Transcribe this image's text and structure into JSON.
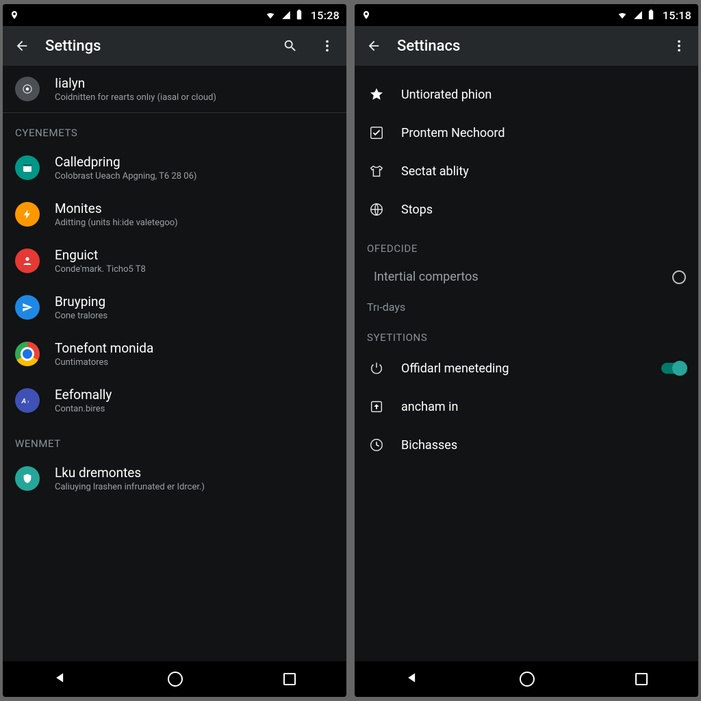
{
  "phones": {
    "left": {
      "statusbar": {
        "time": "15:28"
      },
      "appbar": {
        "title": "Settings",
        "has_search": true,
        "has_more": true
      },
      "hero": {
        "title": "Iialyn",
        "subtitle": "Coidnitten for rearts onlıy (iasal or cloud)"
      },
      "sections": [
        {
          "header": "CYENEMETS",
          "items": [
            {
              "title": "Calledpring",
              "subtitle": "Colobrast Ueach Apgning, T6 28 06)",
              "icon": "calendar",
              "color": "c-teal"
            },
            {
              "title": "Monites",
              "subtitle": "Aditting (units hi:ide valetegoo)",
              "icon": "bolt",
              "color": "c-orange"
            },
            {
              "title": "Enguict",
              "subtitle": "Conde'mark. Ticho5 T8",
              "icon": "person",
              "color": "c-red"
            },
            {
              "title": "Bruyping",
              "subtitle": "Cone tralores",
              "icon": "send",
              "color": "c-blue"
            },
            {
              "title": "Tonefont monida",
              "subtitle": "Cuntimatores",
              "icon": "chrome",
              "color": "c-chrome"
            },
            {
              "title": "Eefomally",
              "subtitle": "Contan.bires",
              "icon": "az",
              "color": "c-azure"
            }
          ]
        },
        {
          "header": "WENMET",
          "items": [
            {
              "title": "Lku dremontes",
              "subtitle": "Caliuying lrashen infrunated er Idrcer.)",
              "icon": "shield",
              "color": "c-mint"
            }
          ]
        }
      ]
    },
    "right": {
      "statusbar": {
        "time": "15:18"
      },
      "appbar": {
        "title": "Settinacs",
        "has_search": false,
        "has_more": true
      },
      "top_items": [
        {
          "title": "Untiorated phion",
          "icon": "star"
        },
        {
          "title": "Prontem Nechoord",
          "icon": "checkbox"
        },
        {
          "title": "Sectat ablity",
          "icon": "shirt"
        },
        {
          "title": "Stops",
          "icon": "globe"
        }
      ],
      "groups": [
        {
          "header": "OFEDCIDE",
          "rows": [
            {
              "text": "Intertial compertos",
              "trailing": "radio"
            },
            {
              "text": "Trı-days",
              "trailing": null
            }
          ]
        },
        {
          "header": "SYETITIONS",
          "rows": [
            {
              "text": "Offidarl meneteding",
              "icon": "power",
              "trailing": "switch"
            },
            {
              "text": "ancham in",
              "icon": "boxed-arrow",
              "trailing": null
            },
            {
              "text": "Bichasses",
              "icon": "clock",
              "trailing": null
            }
          ]
        }
      ]
    }
  }
}
